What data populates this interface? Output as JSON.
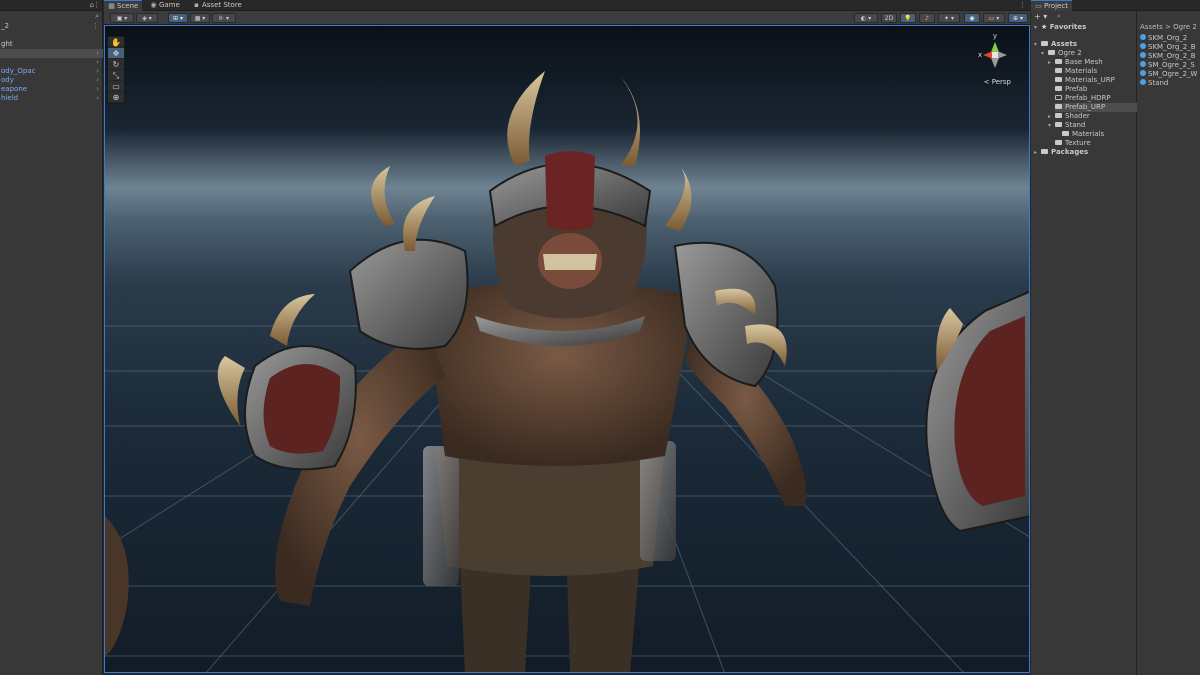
{
  "hierarchy": {
    "rows": [
      {
        "text": "_2",
        "color": "normal"
      },
      {
        "text": "ght",
        "color": "normal"
      },
      {
        "text": "ody_Opac",
        "color": "blue"
      },
      {
        "text": "ody",
        "color": "blue"
      },
      {
        "text": "eapone",
        "color": "blue"
      },
      {
        "text": "hield",
        "color": "blue"
      }
    ]
  },
  "scene": {
    "tabs": {
      "scene": "Scene",
      "game": "Game",
      "asset_store": "Asset Store"
    },
    "toolbar": {
      "mode_2d": "2D"
    },
    "gizmo": {
      "label": "< Persp",
      "y": "y",
      "x": "x"
    }
  },
  "project": {
    "tab": "Project",
    "tree": {
      "favorites": "Favorites",
      "assets": "Assets",
      "ogre2": "Ogre 2",
      "base_mesh": "Base Mesh",
      "materials": "Materials",
      "materials_urp": "Materials_URP",
      "prefab": "Prefab",
      "prefab_hdrp": "Prefab_HDRP",
      "prefab_urp": "Prefab_URP",
      "shader": "Shader",
      "stand": "Stand",
      "stand_materials": "Materials",
      "texture": "Texture",
      "packages": "Packages"
    },
    "breadcrumb": {
      "root": "Assets",
      "sep": ">",
      "folder": "Ogre 2",
      "end": ">"
    },
    "assets": [
      "SKM_Org_2",
      "SKM_Org_2_B",
      "SKM_Org_2_B",
      "SM_Ogre_2_S",
      "SM_Ogre_2_W",
      "Stand"
    ]
  },
  "colors": {
    "accent": "#3a79d8",
    "panel": "#383838",
    "dark": "#282828"
  }
}
